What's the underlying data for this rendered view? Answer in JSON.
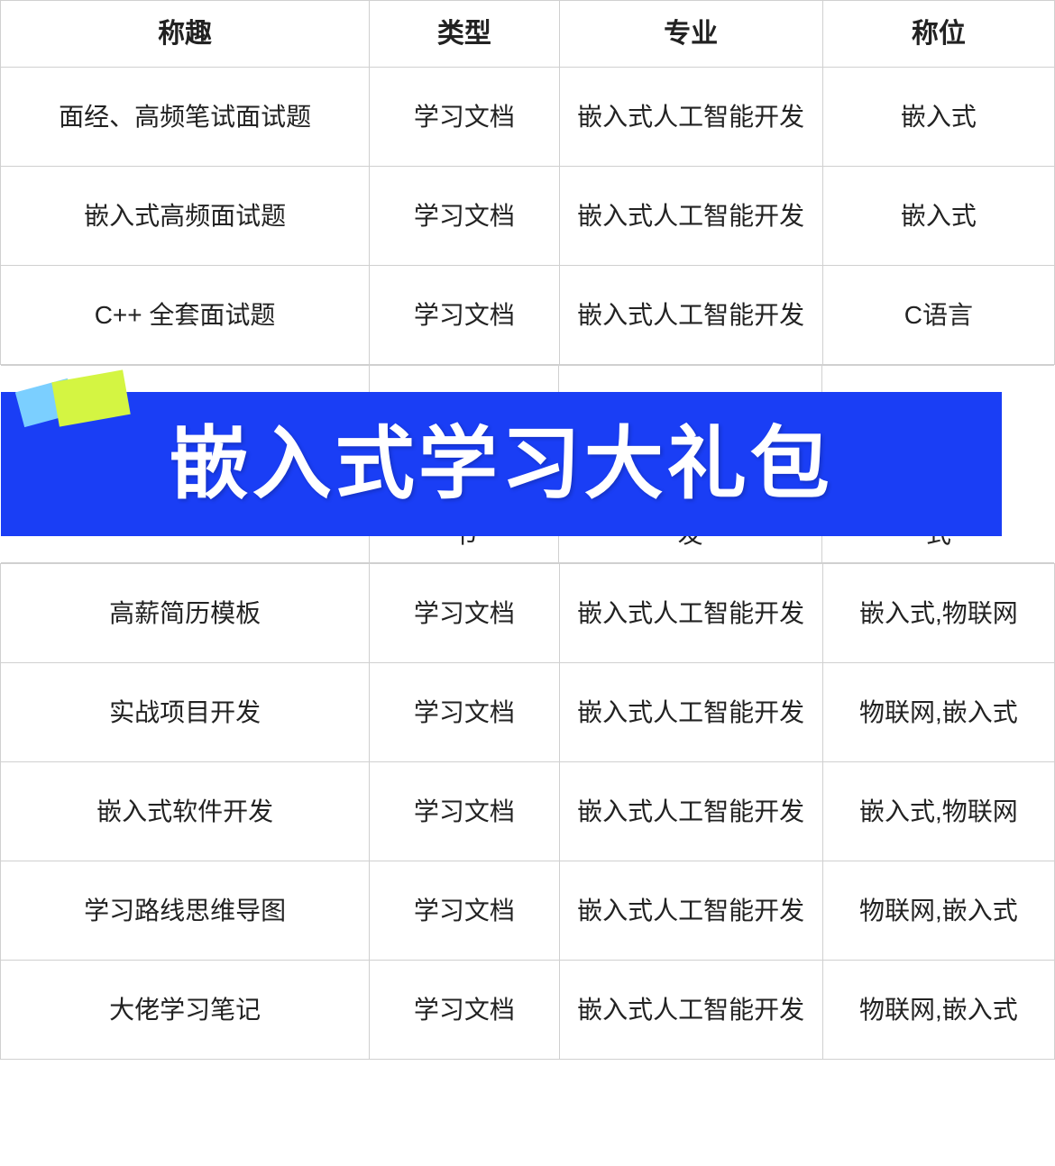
{
  "table": {
    "headers": [
      "称趣",
      "类型",
      "专业",
      "称位"
    ],
    "rows": [
      {
        "id": "row-1",
        "col1": "面经、高频笔试面试题",
        "col2": "学习文档",
        "col3": "嵌入式人工智能开发",
        "col4": "嵌入式"
      },
      {
        "id": "row-2",
        "col1": "嵌入式高频面试题",
        "col2": "学习文档",
        "col3": "嵌入式人工智能开发",
        "col4": "嵌入式"
      },
      {
        "id": "row-3",
        "col1": "C++ 全套面试题",
        "col2": "学习文档",
        "col3": "嵌入式人工智能开发",
        "col4": "C语言"
      },
      {
        "id": "row-partial",
        "col1": "",
        "col2": "书",
        "col3": "发",
        "col4": "式"
      },
      {
        "id": "row-4",
        "col1": "高薪简历模板",
        "col2": "学习文档",
        "col3": "嵌入式人工智能开发",
        "col4": "嵌入式,物联网"
      },
      {
        "id": "row-5",
        "col1": "实战项目开发",
        "col2": "学习文档",
        "col3": "嵌入式人工智能开发",
        "col4": "物联网,嵌入式"
      },
      {
        "id": "row-6",
        "col1": "嵌入式软件开发",
        "col2": "学习文档",
        "col3": "嵌入式人工智能开发",
        "col4": "嵌入式,物联网"
      },
      {
        "id": "row-7",
        "col1": "学习路线思维导图",
        "col2": "学习文档",
        "col3": "嵌入式人工智能开发",
        "col4": "物联网,嵌入式"
      },
      {
        "id": "row-8",
        "col1": "大佬学习笔记",
        "col2": "学习文档",
        "col3": "嵌入式人工智能开发",
        "col4": "物联网,嵌入式"
      }
    ],
    "banner_text": "嵌入式学习大礼包",
    "banner_bg": "#1a3ef5",
    "partial_row": {
      "col2": "书",
      "col3": "发",
      "col4": "式"
    }
  }
}
